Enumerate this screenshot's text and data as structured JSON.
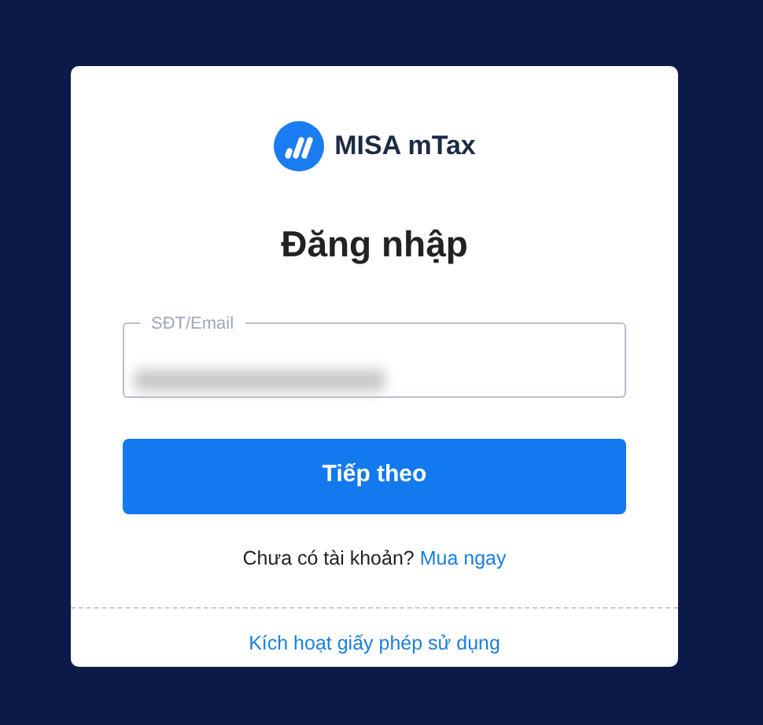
{
  "logo": {
    "text": "MISA mTax"
  },
  "title": "Đăng nhập",
  "field": {
    "label": "SĐT/Email",
    "value_redacted": true
  },
  "submit": "Tiếp theo",
  "signup": {
    "prompt": "Chưa có tài khoản?",
    "link": "Mua ngay"
  },
  "license_link": "Kích hoạt giấy phép sử dụng"
}
